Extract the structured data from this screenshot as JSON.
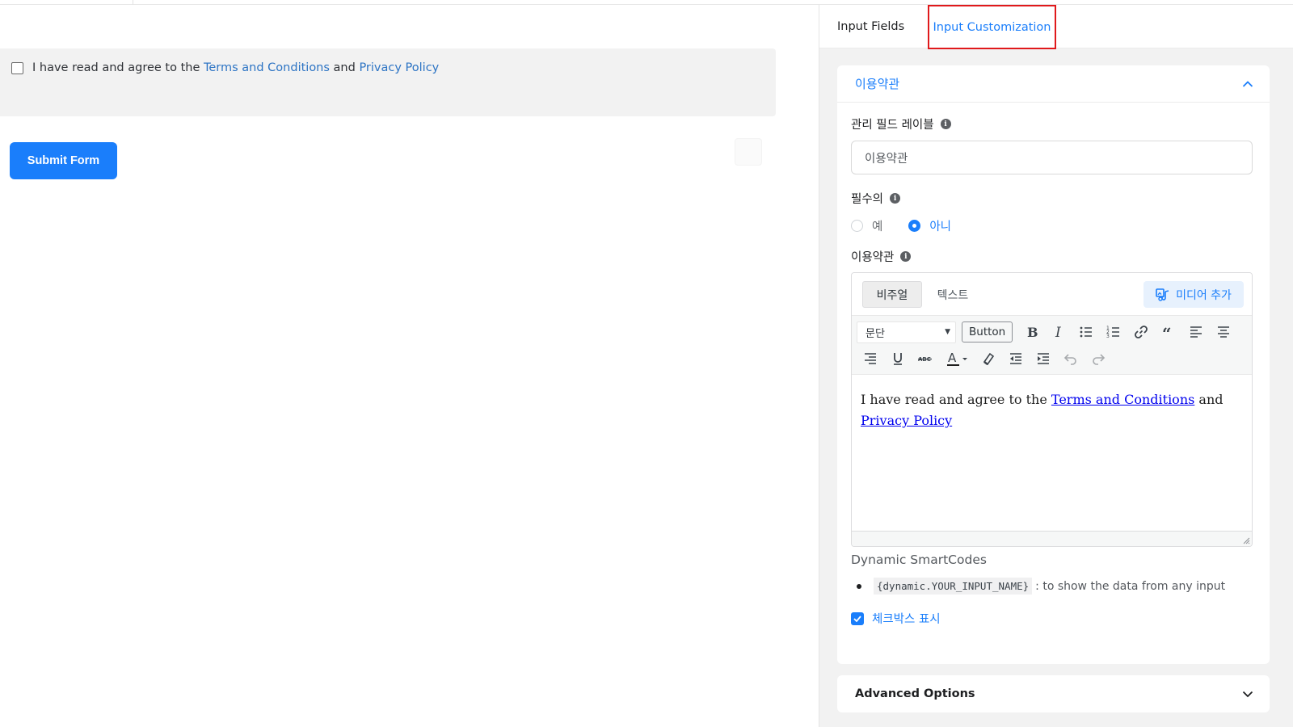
{
  "canvas": {
    "tos_prefix": "I have read and agree to the",
    "tos_link1": "Terms and Conditions",
    "tos_and": "and",
    "tos_link2": "Privacy Policy",
    "submit_label": "Submit Form"
  },
  "tabs": {
    "fields": "Input Fields",
    "customization": "Input Customization"
  },
  "section": {
    "title": "이용약관",
    "admin_label": "관리 필드 레이블",
    "admin_value": "이용약관",
    "required_label": "필수의",
    "required_options": [
      "예",
      "아니"
    ],
    "required_selected": "아니",
    "tos_label": "이용약관"
  },
  "editor": {
    "mode_visual": "비주얼",
    "mode_text": "텍스트",
    "add_media": "미디어 추가",
    "format_select": "문단",
    "button_tag": "Button",
    "content_prefix": "I have read and agree to the",
    "content_link1": "Terms and Conditions",
    "content_and": "and",
    "content_link2": "Privacy Policy"
  },
  "smartcodes": {
    "title": "Dynamic SmartCodes",
    "code": "{dynamic.YOUR_INPUT_NAME}",
    "desc": ": to show the data from any input"
  },
  "show_checkbox": {
    "label": "체크박스 표시",
    "checked": true
  },
  "advanced": {
    "title": "Advanced Options"
  },
  "colors": {
    "accent": "#1a7efb",
    "highlight_border": "#e0191b",
    "panel_bg": "#f2f2f2"
  }
}
